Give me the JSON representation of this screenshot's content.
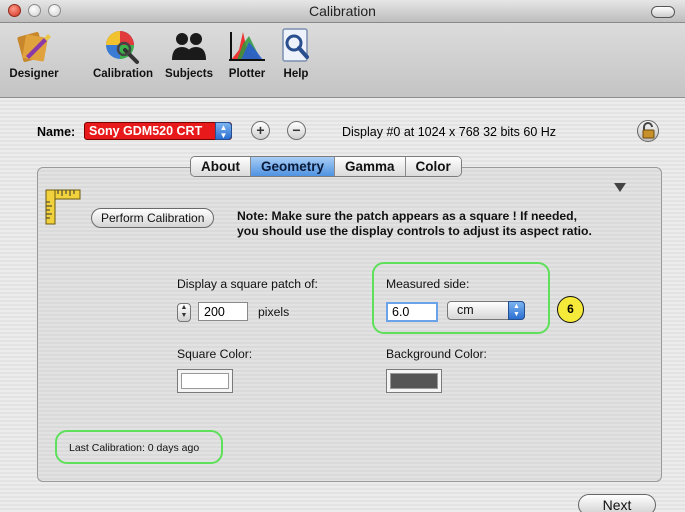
{
  "window": {
    "title": "Calibration"
  },
  "toolbar": {
    "items": [
      {
        "label": "Designer",
        "icon": "designer-icon"
      },
      {
        "label": "Calibration",
        "icon": "calibration-icon"
      },
      {
        "label": "Subjects",
        "icon": "subjects-icon"
      },
      {
        "label": "Plotter",
        "icon": "plotter-icon"
      },
      {
        "label": "Help",
        "icon": "help-icon"
      }
    ]
  },
  "display_row": {
    "name_label": "Name:",
    "name_value": "Sony GDM520 CRT",
    "add_label": "+",
    "remove_label": "−",
    "display_info": "Display #0 at 1024 x 768  32 bits  60 Hz"
  },
  "tabs": [
    {
      "label": "About",
      "active": false
    },
    {
      "label": "Geometry",
      "active": true
    },
    {
      "label": "Gamma",
      "active": false
    },
    {
      "label": "Color",
      "active": false
    }
  ],
  "geometry": {
    "perform_button": "Perform Calibration",
    "note_line1": "Note: Make sure the patch appears as a square ! If needed,",
    "note_line2": "you should use the display controls to adjust its aspect ratio.",
    "patch_label": "Display a square patch of:",
    "patch_value": "200",
    "patch_unit": "pixels",
    "measured_label": "Measured side:",
    "measured_value": "6.0",
    "measured_unit": "cm",
    "square_color_label": "Square Color:",
    "background_color_label": "Background Color:",
    "square_color": "#ffffff",
    "background_color": "#555555",
    "last_calibration": "Last Calibration: 0 days ago"
  },
  "annotation": {
    "badge": "6",
    "highlight_color": "#5ee05a"
  },
  "footer": {
    "next_label": "Next"
  }
}
